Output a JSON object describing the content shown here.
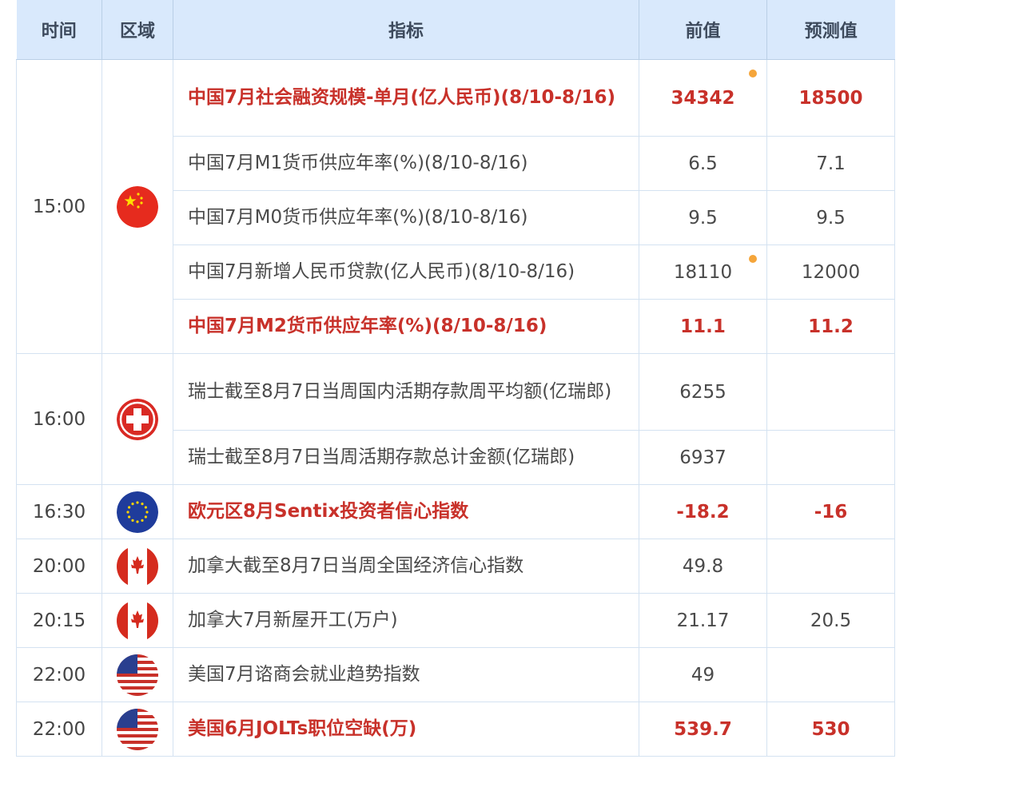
{
  "header": {
    "time": "时间",
    "region": "区域",
    "indicator": "指标",
    "previous": "前值",
    "forecast": "预测值"
  },
  "rows": [
    {
      "time": "15:00",
      "region_icon": "china-flag-icon",
      "indicator": "中国7月社会融资规模-单月(亿人民币)(8/10-8/16)",
      "previous": "34342",
      "forecast": "18500",
      "important": true,
      "dot": true
    },
    {
      "indicator": "中国7月M1货币供应年率(%)(8/10-8/16)",
      "previous": "6.5",
      "forecast": "7.1",
      "important": false
    },
    {
      "indicator": "中国7月M0货币供应年率(%)(8/10-8/16)",
      "previous": "9.5",
      "forecast": "9.5",
      "important": false
    },
    {
      "indicator": "中国7月新增人民币贷款(亿人民币)(8/10-8/16)",
      "previous": "18110",
      "forecast": "12000",
      "important": false,
      "dot": true
    },
    {
      "indicator": "中国7月M2货币供应年率(%)(8/10-8/16)",
      "previous": "11.1",
      "forecast": "11.2",
      "important": true
    },
    {
      "time": "16:00",
      "region_icon": "switzerland-flag-icon",
      "indicator": "瑞士截至8月7日当周国内活期存款周平均额(亿瑞郎)",
      "previous": "6255",
      "forecast": "",
      "important": false
    },
    {
      "indicator": "瑞士截至8月7日当周活期存款总计金额(亿瑞郎)",
      "previous": "6937",
      "forecast": "",
      "important": false
    },
    {
      "time": "16:30",
      "region_icon": "eu-flag-icon",
      "indicator": "欧元区8月Sentix投资者信心指数",
      "previous": "-18.2",
      "forecast": "-16",
      "important": true
    },
    {
      "time": "20:00",
      "region_icon": "canada-flag-icon",
      "indicator": "加拿大截至8月7日当周全国经济信心指数",
      "previous": "49.8",
      "forecast": "",
      "important": false
    },
    {
      "time": "20:15",
      "region_icon": "canada-flag-icon",
      "indicator": "加拿大7月新屋开工(万户)",
      "previous": "21.17",
      "forecast": "20.5",
      "important": false
    },
    {
      "time": "22:00",
      "region_icon": "us-flag-icon",
      "indicator": "美国7月谘商会就业趋势指数",
      "previous": "49",
      "forecast": "",
      "important": false
    },
    {
      "time": "22:00",
      "region_icon": "us-flag-icon",
      "indicator": "美国6月JOLTs职位空缺(万)",
      "previous": "539.7",
      "forecast": "530",
      "important": true
    }
  ],
  "colors": {
    "important_text": "#c8312a",
    "header_bg": "#d9e9fc",
    "dot": "#f5a53a"
  }
}
